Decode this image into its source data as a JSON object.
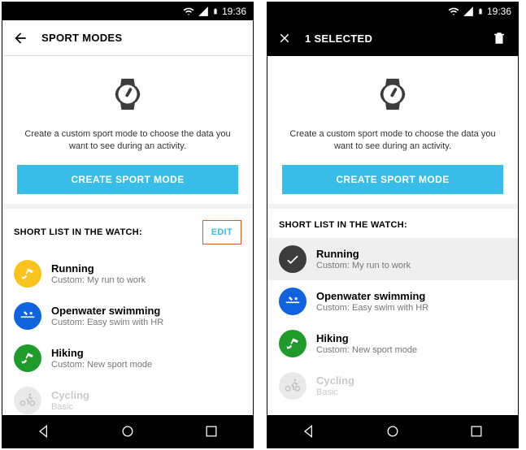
{
  "status": {
    "time": "19:36"
  },
  "left": {
    "appbar": {
      "title": "SPORT MODES"
    },
    "hero": {
      "text": "Create a custom sport mode to choose the data you want to see during an activity.",
      "button": "CREATE SPORT MODE"
    },
    "subheader": {
      "title": "SHORT LIST IN THE WATCH:",
      "edit": "EDIT"
    },
    "items": [
      {
        "title": "Running",
        "sub": "Custom: My run to work",
        "badge_color": "#f8c31a",
        "icon": "running",
        "state": "normal"
      },
      {
        "title": "Openwater swimming",
        "sub": "Custom: Easy swim with HR",
        "badge_color": "#0f62e0",
        "icon": "swimming",
        "state": "normal"
      },
      {
        "title": "Hiking",
        "sub": "Custom: New sport mode",
        "badge_color": "#1f9b2c",
        "icon": "hiking",
        "state": "normal"
      },
      {
        "title": "Cycling",
        "sub": "Basic",
        "badge_color": "#e9e9e9",
        "icon": "cycling",
        "state": "disabled"
      }
    ]
  },
  "right": {
    "appbar": {
      "title": "1 SELECTED"
    },
    "hero": {
      "text": "Create a custom sport mode to choose the data you want to see during an activity.",
      "button": "CREATE SPORT MODE"
    },
    "subheader": {
      "title": "SHORT LIST IN THE WATCH:"
    },
    "items": [
      {
        "title": "Running",
        "sub": "Custom: My run to work",
        "badge_color": "#3c3c3c",
        "icon": "check",
        "state": "selected"
      },
      {
        "title": "Openwater swimming",
        "sub": "Custom: Easy swim with HR",
        "badge_color": "#0f62e0",
        "icon": "swimming",
        "state": "normal"
      },
      {
        "title": "Hiking",
        "sub": "Custom: New sport mode",
        "badge_color": "#1f9b2c",
        "icon": "hiking",
        "state": "normal"
      },
      {
        "title": "Cycling",
        "sub": "Basic",
        "badge_color": "#e9e9e9",
        "icon": "cycling",
        "state": "disabled"
      }
    ]
  }
}
